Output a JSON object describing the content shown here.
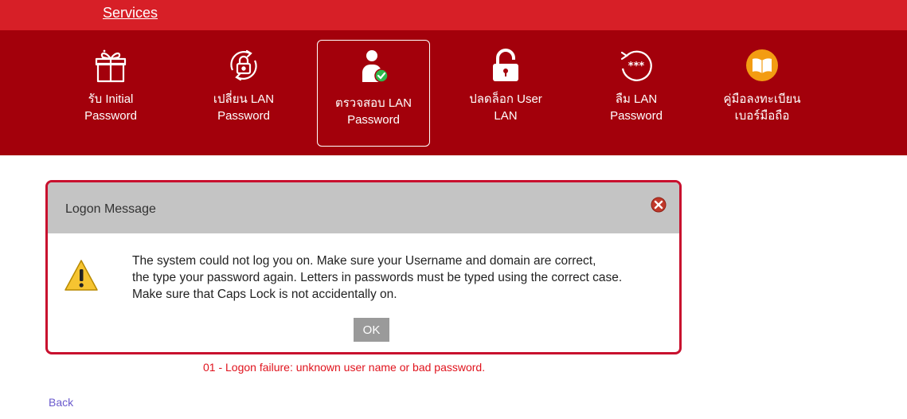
{
  "header": {
    "services_label": "Services"
  },
  "nav": {
    "items": [
      {
        "line1": "รับ Initial",
        "line2": "Password",
        "icon": "gift-icon",
        "active": false
      },
      {
        "line1": "เปลี่ยน LAN",
        "line2": "Password",
        "icon": "lock-refresh-icon",
        "active": false
      },
      {
        "line1": "ตรวจสอบ LAN",
        "line2": "Password",
        "icon": "user-check-icon",
        "active": true
      },
      {
        "line1": "ปลดล็อก User",
        "line2": "LAN",
        "icon": "unlock-icon",
        "active": false
      },
      {
        "line1": "ลืม LAN",
        "line2": "Password",
        "icon": "password-reset-icon",
        "active": false
      },
      {
        "line1": "คู่มือลงทะเบียน",
        "line2": "เบอร์มือถือ",
        "icon": "manual-book-icon",
        "active": false
      }
    ]
  },
  "dialog": {
    "title": "Logon Message",
    "message_line1": "The system could not log you on. Make sure your Username and domain are correct,",
    "message_line2": "the type your password again. Letters in passwords must be typed using the correct case.",
    "message_line3": "Make sure that Caps Lock is not accidentally on.",
    "ok_label": "OK"
  },
  "error_text": "01 - Logon failure: unknown user name or bad password.",
  "back_label": "Back",
  "colors": {
    "topbar": "#d71f27",
    "navbar": "#a3000b",
    "dialog_border": "#c8102e",
    "error_text": "#e0131d",
    "link": "#6a5acd"
  }
}
